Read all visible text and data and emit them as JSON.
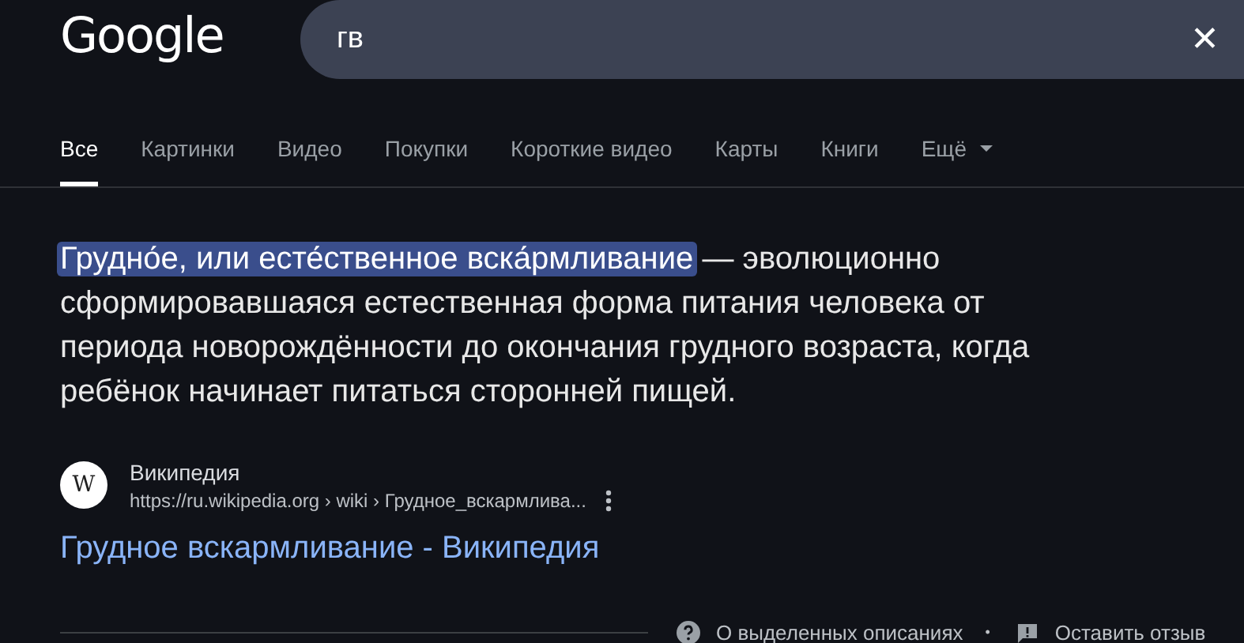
{
  "header": {
    "logo": "Google",
    "search": {
      "value": "гв",
      "clear": "✕"
    }
  },
  "tabs": [
    {
      "label": "Все",
      "selected": true
    },
    {
      "label": "Картинки",
      "selected": false
    },
    {
      "label": "Видео",
      "selected": false
    },
    {
      "label": "Покупки",
      "selected": false
    },
    {
      "label": "Короткие видео",
      "selected": false
    },
    {
      "label": "Карты",
      "selected": false
    },
    {
      "label": "Книги",
      "selected": false
    },
    {
      "label": "Ещё",
      "selected": false,
      "dropdown": true
    }
  ],
  "snippet": {
    "highlight": "Грудно́е, или есте́ственное вска́рмливание",
    "rest": " — эволюционно сформировавшаяся естественная форма питания человека от периода новорождённости до окончания грудного возраста, когда ребёнок начинает питаться сторонней пищей."
  },
  "source": {
    "icon_letter": "W",
    "site": "Википедия",
    "url": "https://ru.wikipedia.org › wiki › Грудное_вскармлива...",
    "title": "Грудное вскармливание - Википедия"
  },
  "footer": {
    "about": "О выделенных описаниях",
    "separator": "•",
    "feedback": "Оставить отзыв"
  }
}
